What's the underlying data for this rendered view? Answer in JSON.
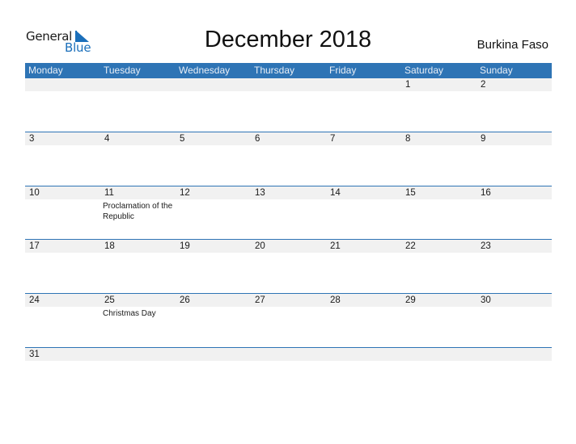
{
  "logo": {
    "word1": "General",
    "word2": "Blue",
    "icon": "triangle-flag-icon"
  },
  "title": "December 2018",
  "country": "Burkina Faso",
  "colors": {
    "header_bg": "#2e74b5",
    "row_bg": "#f1f1f1",
    "brand_blue": "#1b6fba"
  },
  "weekdays": [
    "Monday",
    "Tuesday",
    "Wednesday",
    "Thursday",
    "Friday",
    "Saturday",
    "Sunday"
  ],
  "weeks": [
    [
      {
        "day": ""
      },
      {
        "day": ""
      },
      {
        "day": ""
      },
      {
        "day": ""
      },
      {
        "day": ""
      },
      {
        "day": "1"
      },
      {
        "day": "2"
      }
    ],
    [
      {
        "day": "3"
      },
      {
        "day": "4"
      },
      {
        "day": "5"
      },
      {
        "day": "6"
      },
      {
        "day": "7"
      },
      {
        "day": "8"
      },
      {
        "day": "9"
      }
    ],
    [
      {
        "day": "10"
      },
      {
        "day": "11",
        "event": "Proclamation of the Republic"
      },
      {
        "day": "12"
      },
      {
        "day": "13"
      },
      {
        "day": "14"
      },
      {
        "day": "15"
      },
      {
        "day": "16"
      }
    ],
    [
      {
        "day": "17"
      },
      {
        "day": "18"
      },
      {
        "day": "19"
      },
      {
        "day": "20"
      },
      {
        "day": "21"
      },
      {
        "day": "22"
      },
      {
        "day": "23"
      }
    ],
    [
      {
        "day": "24"
      },
      {
        "day": "25",
        "event": "Christmas Day"
      },
      {
        "day": "26"
      },
      {
        "day": "27"
      },
      {
        "day": "28"
      },
      {
        "day": "29"
      },
      {
        "day": "30"
      }
    ],
    [
      {
        "day": "31"
      },
      {
        "day": ""
      },
      {
        "day": ""
      },
      {
        "day": ""
      },
      {
        "day": ""
      },
      {
        "day": ""
      },
      {
        "day": ""
      }
    ]
  ]
}
